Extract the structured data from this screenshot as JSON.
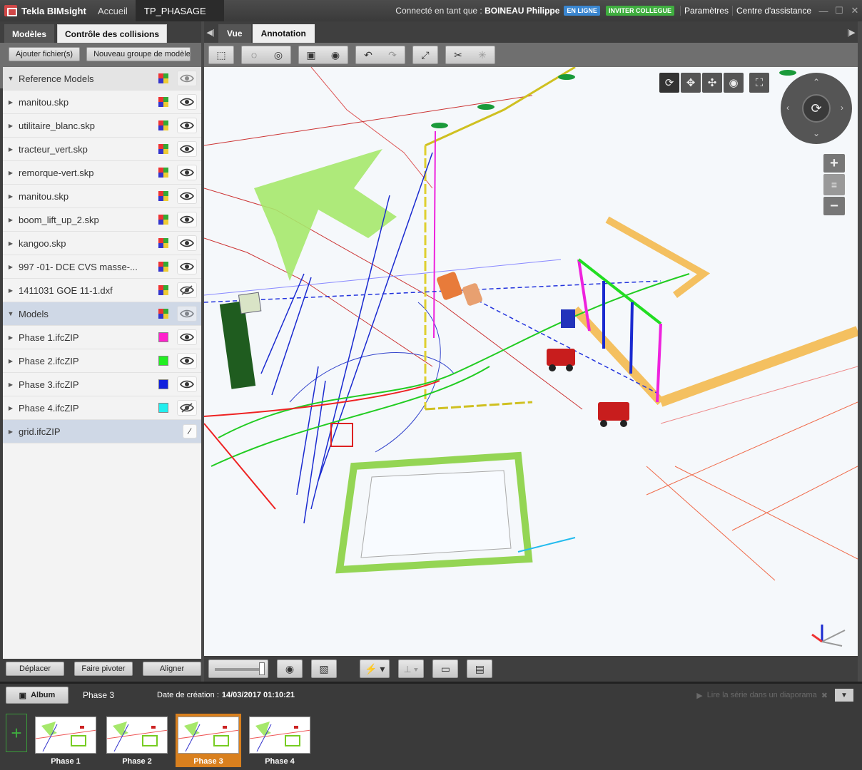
{
  "titlebar": {
    "app_name": "Tekla BIMsight",
    "tabs": [
      {
        "label": "Accueil"
      },
      {
        "label": "TP_PHASAGE"
      }
    ],
    "connected_prefix": "Connecté en tant que :",
    "user": "BOINEAU Philippe",
    "online_badge": "EN LIGNE",
    "invite_badge": "INVITER COLLEGUE",
    "settings": "Paramètres",
    "help": "Centre d'assistance"
  },
  "left": {
    "tabs": [
      {
        "label": "Modèles"
      },
      {
        "label": "Contrôle des collisions"
      }
    ],
    "add_files": "Ajouter fichier(s)",
    "new_group": "Nouveau groupe de modèles",
    "groups": [
      {
        "name": "Reference Models",
        "items": [
          {
            "name": "manitou.skp",
            "hidden": false
          },
          {
            "name": "utilitaire_blanc.skp",
            "hidden": false
          },
          {
            "name": "tracteur_vert.skp",
            "hidden": false
          },
          {
            "name": "remorque-vert.skp",
            "hidden": false
          },
          {
            "name": "manitou.skp",
            "hidden": false
          },
          {
            "name": "boom_lift_up_2.skp",
            "hidden": false
          },
          {
            "name": "kangoo.skp",
            "hidden": false
          },
          {
            "name": "997 -01- DCE CVS masse-...",
            "hidden": false
          },
          {
            "name": "1411031 GOE 11-1.dxf",
            "hidden": true
          }
        ]
      },
      {
        "name": "Models",
        "items": [
          {
            "name": "Phase 1.ifcZIP",
            "color": "#ff22cc",
            "hidden": false
          },
          {
            "name": "Phase 2.ifcZIP",
            "color": "#22ee22",
            "hidden": false
          },
          {
            "name": "Phase 3.ifcZIP",
            "color": "#1020dd",
            "hidden": false
          },
          {
            "name": "Phase 4.ifcZIP",
            "color": "#22eeee",
            "hidden": true
          }
        ]
      }
    ],
    "grid_item": "grid.ifcZIP",
    "bottom": {
      "move": "Déplacer",
      "rotate": "Faire pivoter",
      "align": "Aligner"
    }
  },
  "main": {
    "tabs": [
      {
        "label": "Vue"
      },
      {
        "label": "Annotation"
      }
    ]
  },
  "album": {
    "button": "Album",
    "current_phase": "Phase 3",
    "date_label": "Date de création :",
    "date_value": "14/03/2017 01:10:21",
    "play": "Lire la série dans un diaporama",
    "thumbs": [
      {
        "label": "Phase 1",
        "selected": false
      },
      {
        "label": "Phase 2",
        "selected": false
      },
      {
        "label": "Phase 3",
        "selected": true
      },
      {
        "label": "Phase 4",
        "selected": false
      }
    ]
  },
  "colors": {
    "accent_orange": "#d9801e",
    "online": "#3a86d0",
    "invite": "#3fae3f"
  },
  "icons": [
    "select-box-icon",
    "hide-icon",
    "show-icon",
    "snapshot-icon",
    "undo-icon",
    "redo-icon",
    "fit-icon",
    "clip-icon",
    "rotate-icon",
    "pan-icon",
    "fly-icon",
    "look-icon",
    "fullscreen-icon",
    "zoom-in-icon",
    "zoom-out-icon",
    "eye-icon",
    "box-icon",
    "flash-icon",
    "measure-icon",
    "comment-icon",
    "note-icon"
  ]
}
